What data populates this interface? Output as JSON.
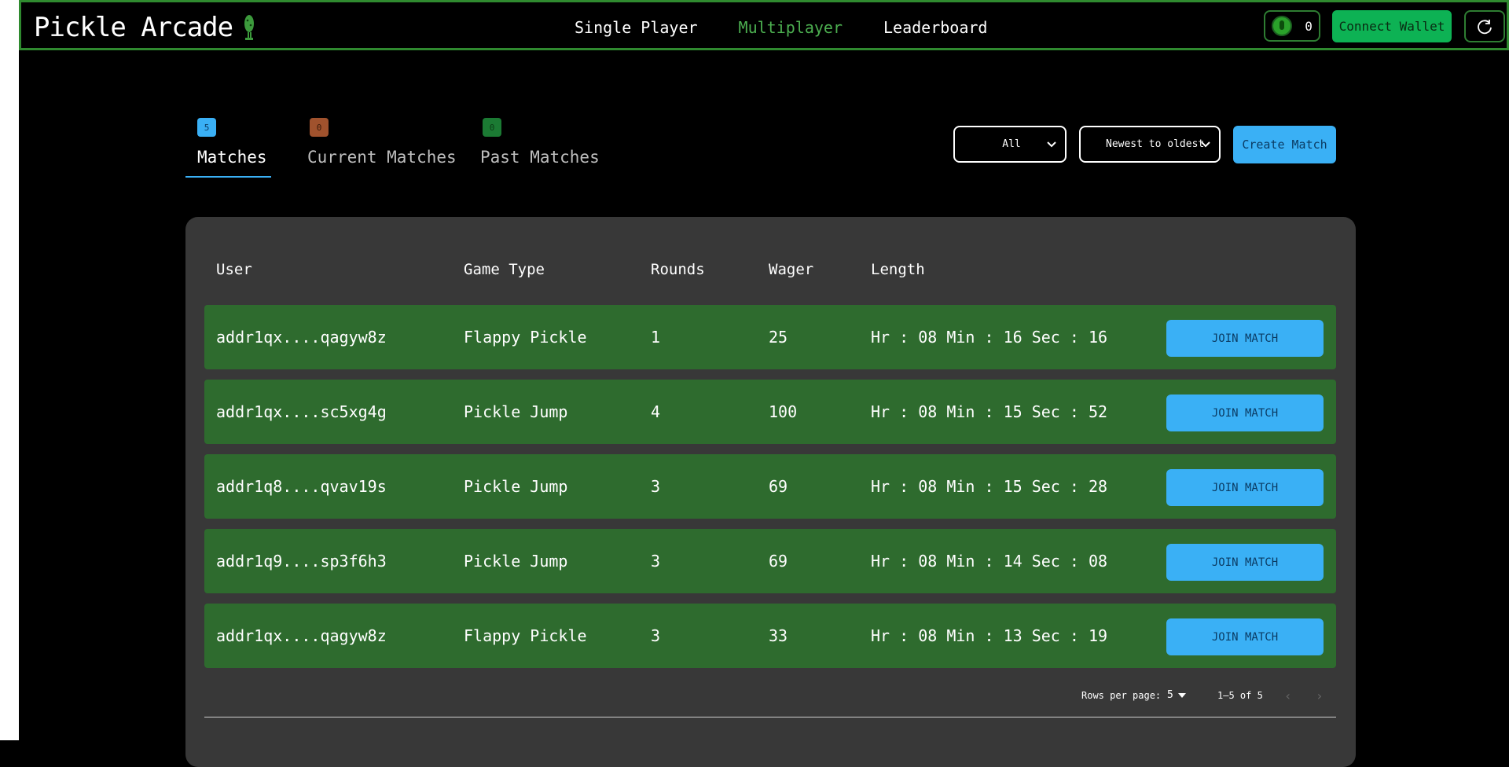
{
  "header": {
    "brand": "Pickle Arcade",
    "nav": [
      "Single Player",
      "Multiplayer",
      "Leaderboard"
    ],
    "active_nav": "Multiplayer",
    "token_count": "0",
    "connect_label": "Connect Wallet"
  },
  "tabs": [
    {
      "badge": "5",
      "label": "Matches"
    },
    {
      "badge": "0",
      "label": "Current Matches"
    },
    {
      "badge": "0",
      "label": "Past Matches"
    }
  ],
  "filters": {
    "filter_value": "All",
    "sort_value": "Newest to oldest",
    "create_label": "Create Match"
  },
  "table": {
    "headers": [
      "User",
      "Game Type",
      "Rounds",
      "Wager",
      "Length"
    ],
    "rows": [
      {
        "user": "addr1qx....qagyw8z",
        "game": "Flappy Pickle",
        "rounds": "1",
        "wager": "25",
        "length": "Hr : 08 Min : 16 Sec : 16",
        "action": "JOIN MATCH"
      },
      {
        "user": "addr1qx....sc5xg4g",
        "game": "Pickle Jump",
        "rounds": "4",
        "wager": "100",
        "length": "Hr : 08 Min : 15 Sec : 52",
        "action": "JOIN MATCH"
      },
      {
        "user": "addr1q8....qvav19s",
        "game": "Pickle Jump",
        "rounds": "3",
        "wager": "69",
        "length": "Hr : 08 Min : 15 Sec : 28",
        "action": "JOIN MATCH"
      },
      {
        "user": "addr1q9....sp3f6h3",
        "game": "Pickle Jump",
        "rounds": "3",
        "wager": "69",
        "length": "Hr : 08 Min : 14 Sec : 08",
        "action": "JOIN MATCH"
      },
      {
        "user": "addr1qx....qagyw8z",
        "game": "Flappy Pickle",
        "rounds": "3",
        "wager": "33",
        "length": "Hr : 08 Min : 13 Sec : 19",
        "action": "JOIN MATCH"
      }
    ]
  },
  "pagination": {
    "rows_per_page_label": "Rows per page:",
    "rows_per_page": "5",
    "range": "1–5 of 5"
  },
  "colors": {
    "nav_border": "#2f8a2f",
    "accent_green": "#0db254",
    "accent_blue": "#3ab0f5",
    "row_green": "#2e6b2e",
    "card_bg": "#383838"
  }
}
